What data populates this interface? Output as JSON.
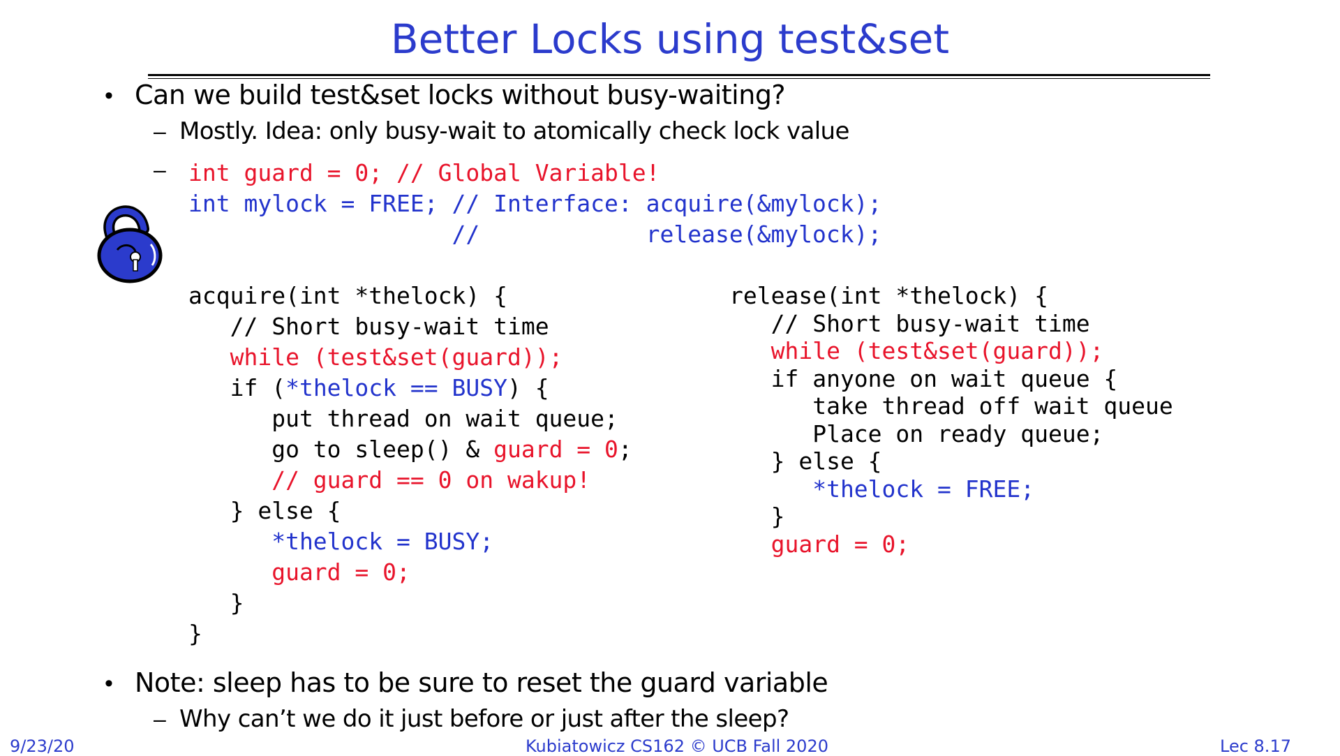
{
  "slide": {
    "title": "Better Locks using test&set",
    "bullet1": "Can we build test&set locks without busy-waiting?",
    "bullet1_sub1": "Mostly.  Idea: only busy-wait to atomically check lock value",
    "bullet2": "Note: sleep has to be sure to reset the guard variable",
    "bullet2_sub1": "Why can’t we do it just before or just after the sleep?",
    "bullet_char": "•",
    "dash_char": "–"
  },
  "globals": {
    "line1": "int guard = 0; // Global Variable!",
    "line2": "int mylock = FREE; // Interface: acquire(&mylock);",
    "line3": "                   //            release(&mylock);"
  },
  "acquire": {
    "l1": "acquire(int *thelock) {",
    "l2": "   // Short busy-wait time",
    "l3": "   while (test&set(guard));",
    "l4a": "   if (",
    "l4b": "*thelock == BUSY",
    "l4c": ") {",
    "l5": "      put thread on wait queue;",
    "l6a": "      go to sleep() & ",
    "l6b": "guard = 0",
    "l6c": ";",
    "l7": "      // guard == 0 on wakup!",
    "l8": "   } else {",
    "l9": "      *thelock = BUSY;",
    "l10": "      guard = 0;",
    "l11": "   }",
    "l12": "}"
  },
  "release": {
    "l1": "release(int *thelock) {",
    "l2": "   // Short busy-wait time",
    "l3": "   while (test&set(guard));",
    "l4": "   if anyone on wait queue {",
    "l5": "      take thread off wait queue",
    "l6": "      Place on ready queue;",
    "l7": "   } else {",
    "l8": "      *thelock = FREE;",
    "l9": "   }",
    "l10": "   guard = 0;"
  },
  "footer": {
    "date": "9/23/20",
    "course": "Kubiatowicz CS162 © UCB Fall 2020",
    "lecture": "Lec 8.17"
  },
  "icons": {
    "lock": "padlock-icon"
  },
  "colors": {
    "title": "#2b3bcc",
    "red": "#e8132a",
    "blue": "#2233cc"
  }
}
